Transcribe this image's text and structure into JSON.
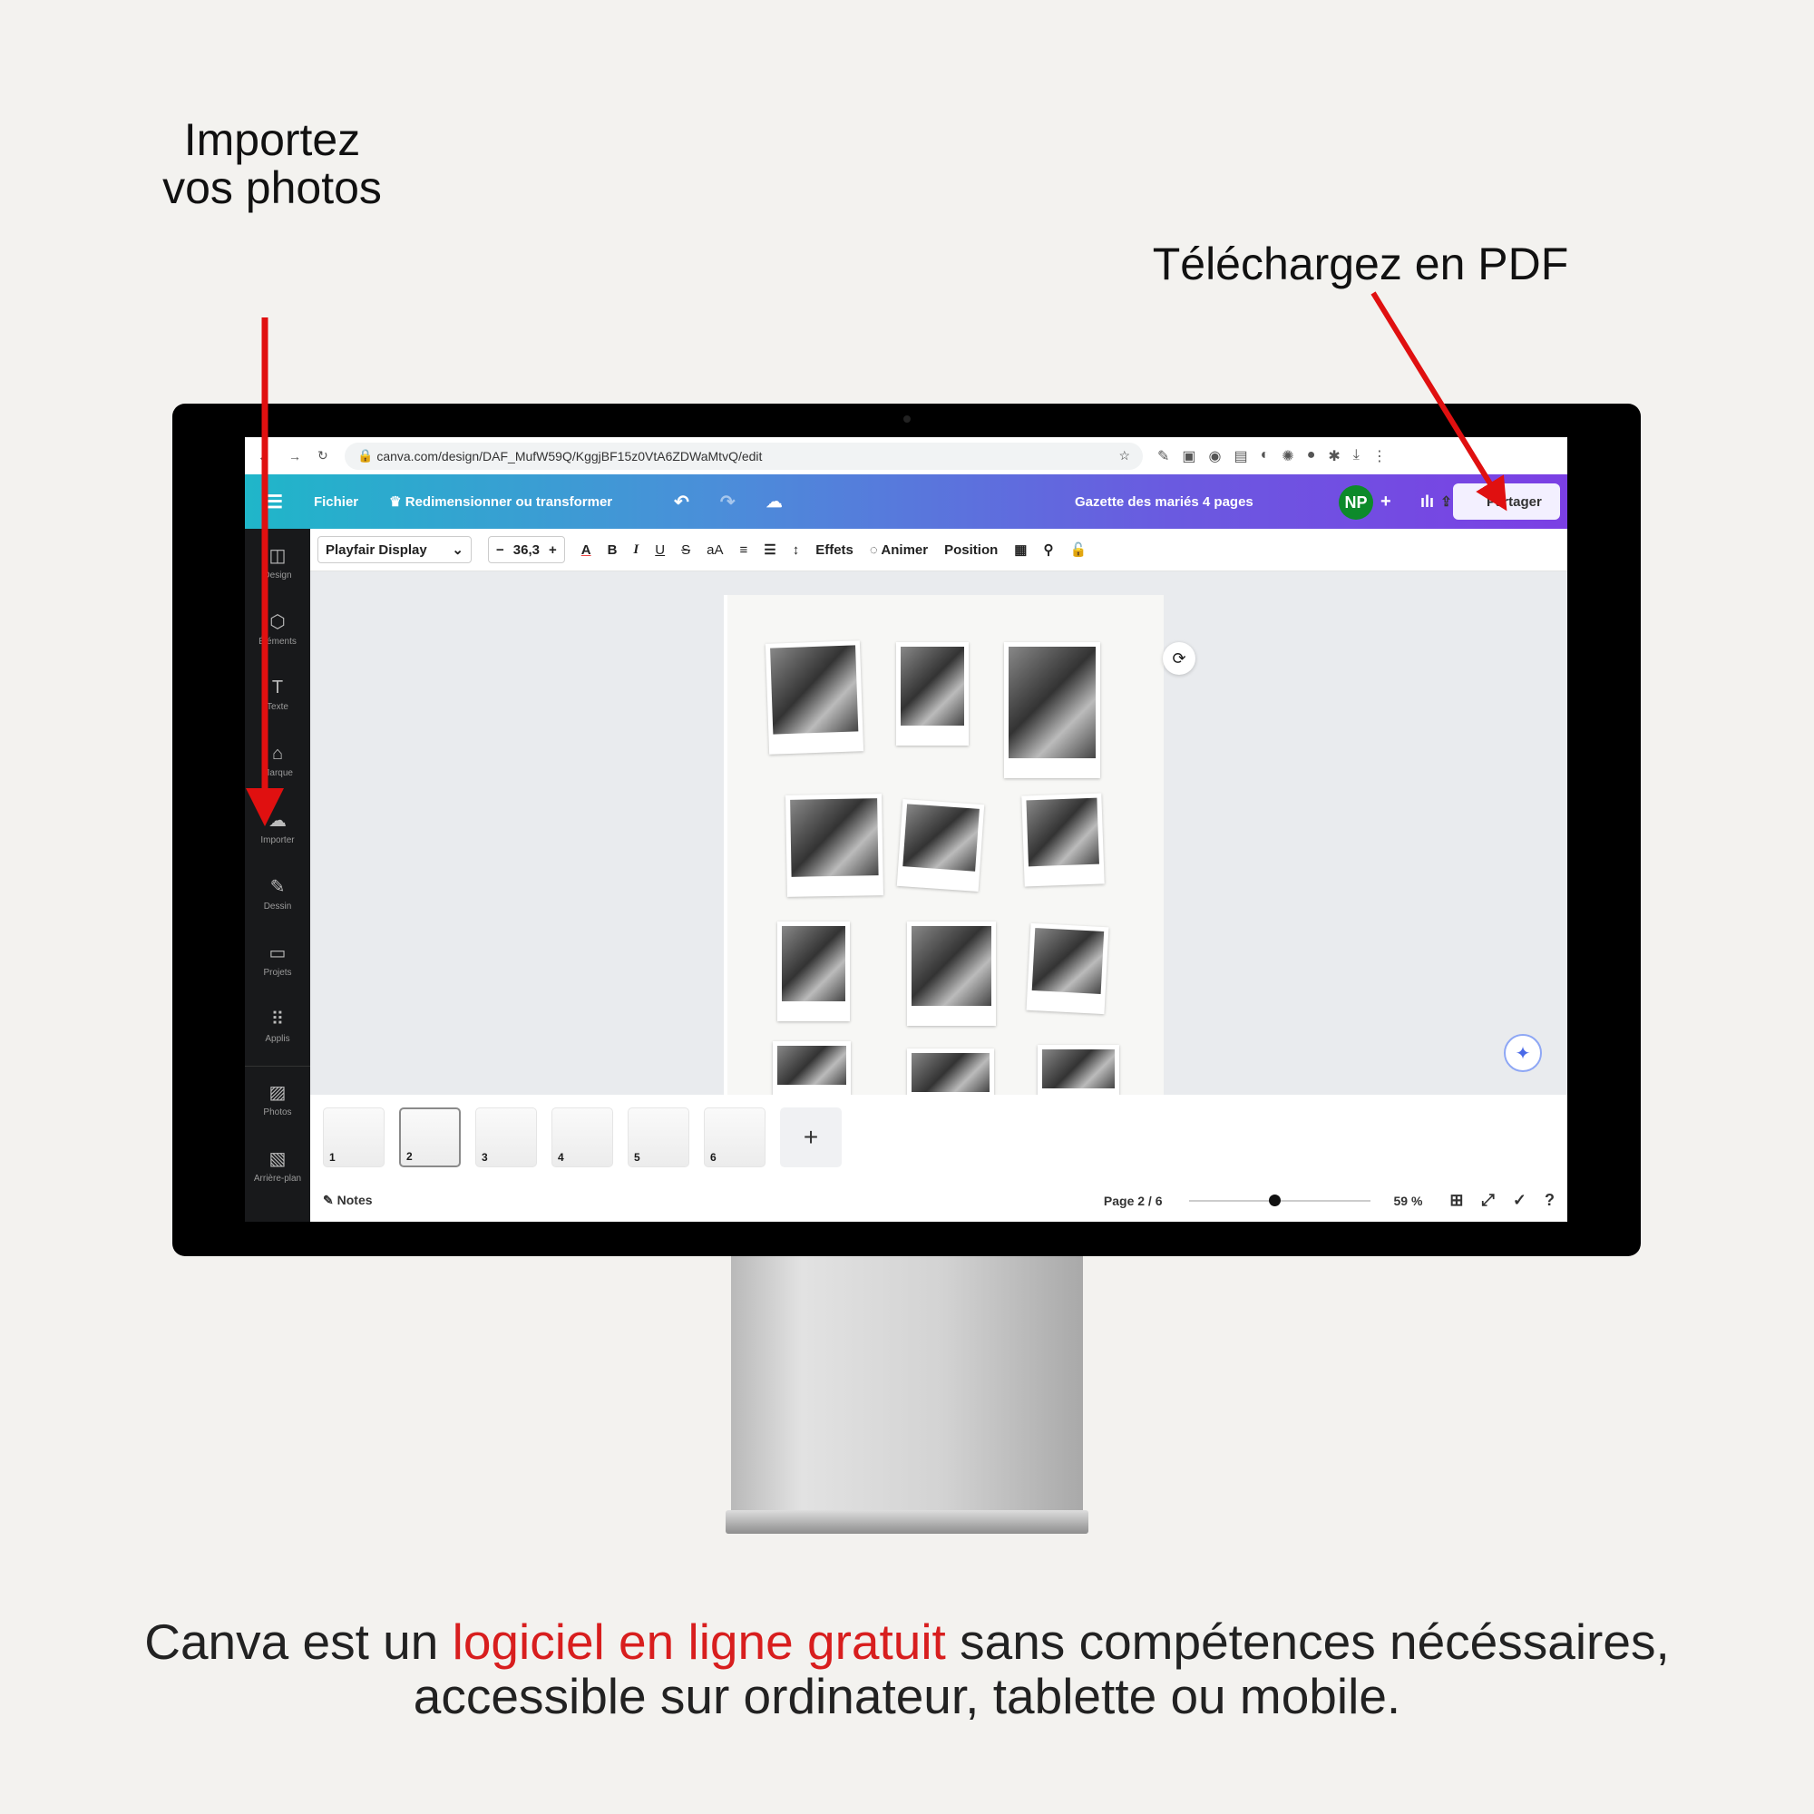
{
  "annotations": {
    "import": "Importez vos photos",
    "download": "Téléchargez en PDF",
    "arrow_color": "#e01010"
  },
  "caption": {
    "part1": "Canva est un ",
    "highlight": "logiciel en ligne gratuit",
    "part2": " sans compétences nécéssaires, accessible sur ordinateur, tablette ou mobile.",
    "highlight_color": "#d81e1e"
  },
  "browser": {
    "url": "canva.com/design/DAF_MufW59Q/KggjBF15z0VtA6ZDWaMtvQ/edit"
  },
  "header": {
    "file": "Fichier",
    "resize": "Redimensionner ou transformer",
    "doc_title": "Gazette des mariés 4 pages",
    "avatar": "NP",
    "share": "Partager",
    "gradient": [
      "#1fb6c9",
      "#7b3fe4"
    ]
  },
  "toolbar": {
    "font": "Playfair Display",
    "size": "36,3",
    "bold": "B",
    "italic": "I",
    "underline": "U",
    "strike": "S",
    "case": "aA",
    "effects": "Effets",
    "animate": "Animer",
    "position": "Position"
  },
  "sidebar": {
    "items": [
      {
        "label": "Design",
        "icon": "layout-icon"
      },
      {
        "label": "Éléments",
        "icon": "shapes-icon"
      },
      {
        "label": "Texte",
        "icon": "text-icon"
      },
      {
        "label": "Marque",
        "icon": "brand-icon"
      },
      {
        "label": "Importer",
        "icon": "upload-cloud-icon"
      },
      {
        "label": "Dessin",
        "icon": "draw-icon"
      },
      {
        "label": "Projets",
        "icon": "folder-icon"
      },
      {
        "label": "Applis",
        "icon": "apps-icon"
      },
      {
        "label": "Photos",
        "icon": "photo-icon"
      },
      {
        "label": "Arrière-plan",
        "icon": "pattern-icon"
      }
    ]
  },
  "pages": {
    "thumbnails": [
      "1",
      "2",
      "3",
      "4",
      "5",
      "6"
    ],
    "selected": "2",
    "add": "+"
  },
  "footer": {
    "notes": "Notes",
    "page": "Page 2 / 6",
    "zoom": "59 %",
    "zoom_value": 59
  }
}
